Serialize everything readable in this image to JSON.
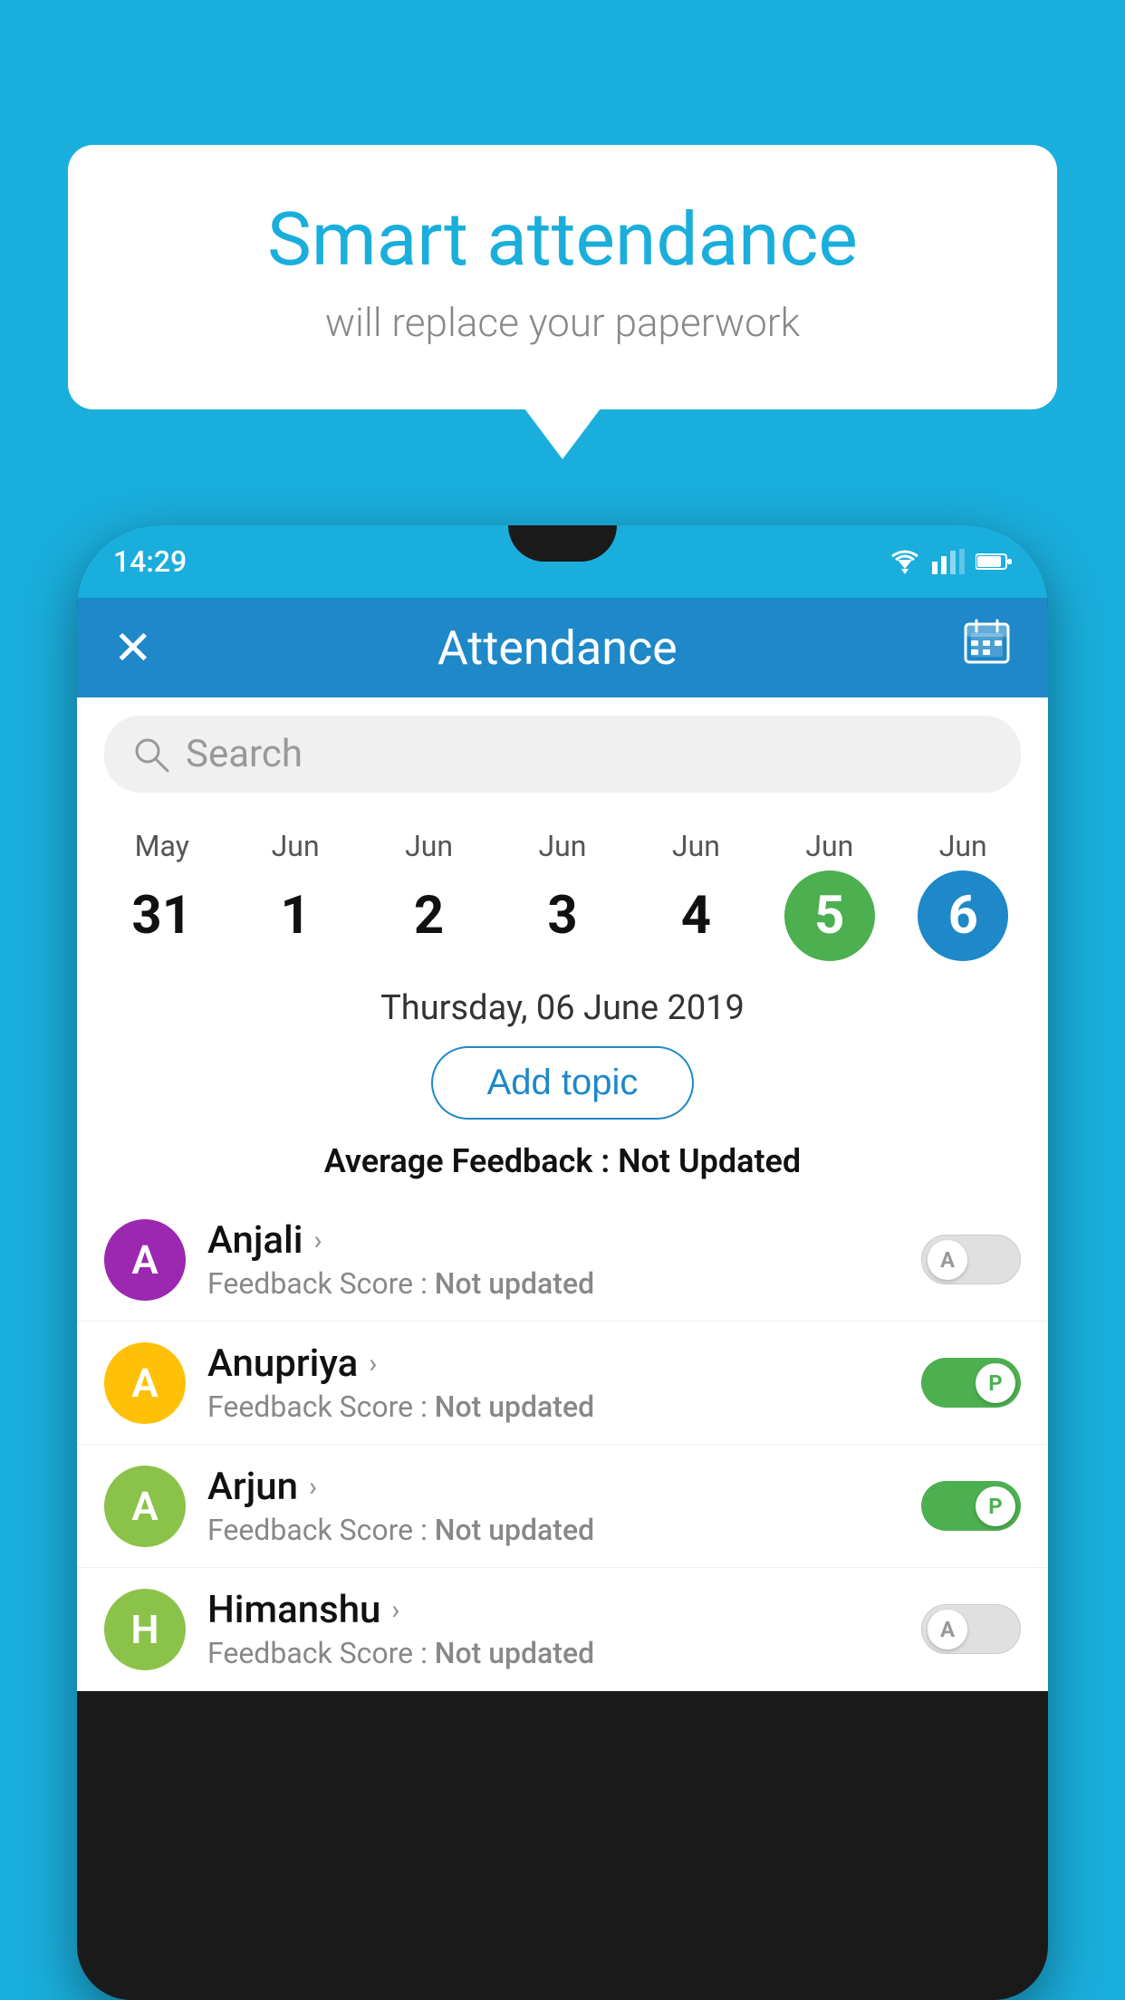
{
  "background_color": "#1AAEDC",
  "bubble": {
    "title": "Smart attendance",
    "subtitle": "will replace your paperwork"
  },
  "status_bar": {
    "time": "14:29"
  },
  "header": {
    "title": "Attendance",
    "close_label": "✕",
    "calendar_label": "📅"
  },
  "search": {
    "placeholder": "Search"
  },
  "calendar": {
    "days": [
      {
        "month": "May",
        "num": "31",
        "highlight": "none"
      },
      {
        "month": "Jun",
        "num": "1",
        "highlight": "none"
      },
      {
        "month": "Jun",
        "num": "2",
        "highlight": "none"
      },
      {
        "month": "Jun",
        "num": "3",
        "highlight": "none"
      },
      {
        "month": "Jun",
        "num": "4",
        "highlight": "none"
      },
      {
        "month": "Jun",
        "num": "5",
        "highlight": "today"
      },
      {
        "month": "Jun",
        "num": "6",
        "highlight": "selected"
      }
    ]
  },
  "date_label": "Thursday, 06 June 2019",
  "add_topic_label": "Add topic",
  "avg_feedback_label": "Average Feedback :",
  "avg_feedback_value": "Not Updated",
  "students": [
    {
      "name": "Anjali",
      "initial": "A",
      "avatar_color": "#9C27B0",
      "score_label": "Feedback Score :",
      "score_value": "Not updated",
      "toggle": "off",
      "toggle_letter": "A"
    },
    {
      "name": "Anupriya",
      "initial": "A",
      "avatar_color": "#FFC107",
      "score_label": "Feedback Score :",
      "score_value": "Not updated",
      "toggle": "on",
      "toggle_letter": "P"
    },
    {
      "name": "Arjun",
      "initial": "A",
      "avatar_color": "#8BC34A",
      "score_label": "Feedback Score :",
      "score_value": "Not updated",
      "toggle": "on",
      "toggle_letter": "P"
    },
    {
      "name": "Himanshu",
      "initial": "H",
      "avatar_color": "#8BC34A",
      "score_label": "Feedback Score :",
      "score_value": "Not updated",
      "toggle": "off",
      "toggle_letter": "A"
    }
  ]
}
